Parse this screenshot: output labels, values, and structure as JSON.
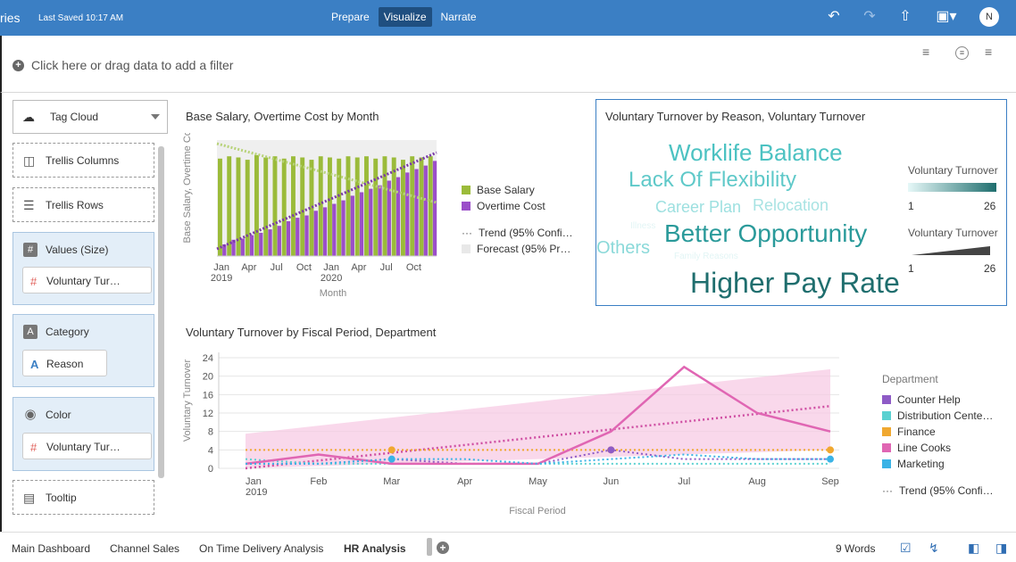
{
  "app": {
    "title_fragment": "ries",
    "last_saved": "Last Saved 10:17 AM"
  },
  "modes": [
    {
      "label": "Prepare",
      "active": false
    },
    {
      "label": "Visualize",
      "active": true
    },
    {
      "label": "Narrate",
      "active": false
    }
  ],
  "user": {
    "initial": "N"
  },
  "filter_bar": {
    "hint": "Click here or drag data to add a filter"
  },
  "grammar": {
    "viz_type": "Tag Cloud",
    "trellis_columns": "Trellis Columns",
    "trellis_rows": "Trellis Rows",
    "values_label": "Values (Size)",
    "values_chip": "Voluntary Tur…",
    "category_label": "Category",
    "category_chip": "Reason",
    "color_label": "Color",
    "color_chip": "Voluntary Tur…",
    "tooltip": "Tooltip"
  },
  "chart1": {
    "title": "Base Salary, Overtime Cost by Month",
    "ylabel": "Base Salary, Overtime Cost",
    "xlabel": "Month",
    "legend": [
      "Base Salary",
      "Overtime Cost",
      "Trend (95% Confi…",
      "Forecast (95% Pr…"
    ]
  },
  "cloud": {
    "title": "Voluntary Turnover by Reason, Voluntary Turnover",
    "legend_color_title": "Voluntary Turnover",
    "legend_size_title": "Voluntary Turnover",
    "legend_min": "1",
    "legend_max": "26",
    "words": [
      "Worklife Balance",
      "Lack Of Flexibility",
      "Career Plan",
      "Relocation",
      "Illness",
      "Better Opportunity",
      "Others",
      "Family Reasons",
      "Higher Pay Rate"
    ]
  },
  "chart2": {
    "title": "Voluntary Turnover by Fiscal Period, Department",
    "ylabel": "Voluntary Turnover",
    "xlabel": "Fiscal Period",
    "legend_title": "Department",
    "legend": [
      "Counter Help",
      "Distribution Cente…",
      "Finance",
      "Line Cooks",
      "Marketing"
    ],
    "trend_label": "Trend (95% Confi…"
  },
  "colors": {
    "topbar": "#3b7fc4",
    "base_salary": "#9bbb3a",
    "overtime": "#9b4fc9",
    "counter_help": "#8e5bc6",
    "distribution": "#5ad1d1",
    "finance": "#f0a830",
    "line_cooks": "#e066b3",
    "marketing": "#3bb3e6",
    "cloud_dark": "#1f6e6e",
    "cloud_light": "#7fd6d6"
  },
  "chart_data": [
    {
      "type": "bar",
      "title": "Base Salary, Overtime Cost by Month",
      "xlabel": "Month",
      "ylabel": "Base Salary, Overtime Cost",
      "x_ticks": [
        "Jan\n2019",
        "Apr",
        "Jul",
        "Oct",
        "Jan\n2020",
        "Apr",
        "Jul",
        "Oct"
      ],
      "months": 24,
      "series": [
        {
          "name": "Base Salary",
          "values": [
            0.84,
            0.86,
            0.85,
            0.83,
            0.87,
            0.85,
            0.86,
            0.84,
            0.86,
            0.85,
            0.83,
            0.86,
            0.85,
            0.84,
            0.86,
            0.85,
            0.86,
            0.84,
            0.86,
            0.85,
            0.83,
            0.86,
            0.85,
            0.86
          ]
        },
        {
          "name": "Overtime Cost",
          "values": [
            0.1,
            0.14,
            0.15,
            0.18,
            0.2,
            0.23,
            0.26,
            0.3,
            0.33,
            0.35,
            0.39,
            0.42,
            0.45,
            0.48,
            0.52,
            0.55,
            0.58,
            0.61,
            0.65,
            0.68,
            0.72,
            0.75,
            0.78,
            0.82
          ]
        }
      ]
    },
    {
      "type": "line",
      "title": "Voluntary Turnover by Fiscal Period, Department",
      "xlabel": "Fiscal Period",
      "ylabel": "Voluntary Turnover",
      "ylim": [
        0,
        24
      ],
      "y_ticks": [
        0,
        4,
        8,
        12,
        16,
        20,
        24
      ],
      "categories": [
        "Jan 2019",
        "Feb",
        "Mar",
        "Apr",
        "May",
        "Jun",
        "Jul",
        "Aug",
        "Sep"
      ],
      "series": [
        {
          "name": "Counter Help",
          "values": [
            1,
            1,
            2,
            1,
            1,
            4,
            2,
            2,
            2
          ]
        },
        {
          "name": "Distribution Cente…",
          "values": [
            2,
            1,
            1,
            1,
            1,
            1,
            1,
            1,
            1
          ]
        },
        {
          "name": "Finance",
          "values": [
            4,
            4,
            4,
            4,
            4,
            4,
            4,
            4,
            4
          ]
        },
        {
          "name": "Line Cooks",
          "values": [
            1,
            3,
            1,
            1,
            1,
            8,
            22,
            12,
            8
          ]
        },
        {
          "name": "Marketing",
          "values": [
            1,
            1,
            2,
            2,
            1,
            2,
            3,
            2,
            2
          ]
        }
      ]
    }
  ]
}
